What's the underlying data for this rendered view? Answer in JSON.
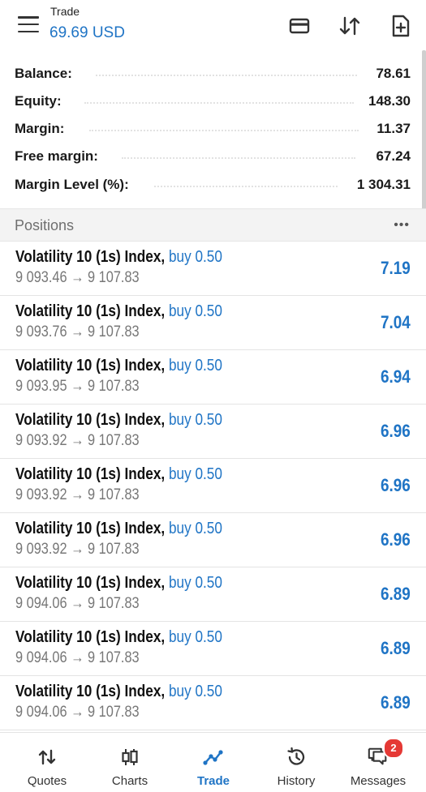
{
  "header": {
    "title": "Trade",
    "subtitle": "69.69 USD",
    "icons": [
      "menu-icon",
      "card-icon",
      "sort-icon",
      "new-order-icon"
    ]
  },
  "summary": [
    {
      "label": "Balance:",
      "value": "78.61"
    },
    {
      "label": "Equity:",
      "value": "148.30"
    },
    {
      "label": "Margin:",
      "value": "11.37"
    },
    {
      "label": "Free margin:",
      "value": "67.24"
    },
    {
      "label": "Margin Level (%):",
      "value": "1 304.31"
    }
  ],
  "positions": {
    "title": "Positions",
    "more_icon": "more-icon",
    "items": [
      {
        "symbol": "Volatility 10 (1s) Index,",
        "side": "buy 0.50",
        "prices": "9 093.46 → 9 107.83",
        "profit": "7.19"
      },
      {
        "symbol": "Volatility 10 (1s) Index,",
        "side": "buy 0.50",
        "prices": "9 093.76 → 9 107.83",
        "profit": "7.04"
      },
      {
        "symbol": "Volatility 10 (1s) Index,",
        "side": "buy 0.50",
        "prices": "9 093.95 → 9 107.83",
        "profit": "6.94"
      },
      {
        "symbol": "Volatility 10 (1s) Index,",
        "side": "buy 0.50",
        "prices": "9 093.92 → 9 107.83",
        "profit": "6.96"
      },
      {
        "symbol": "Volatility 10 (1s) Index,",
        "side": "buy 0.50",
        "prices": "9 093.92 → 9 107.83",
        "profit": "6.96"
      },
      {
        "symbol": "Volatility 10 (1s) Index,",
        "side": "buy 0.50",
        "prices": "9 093.92 → 9 107.83",
        "profit": "6.96"
      },
      {
        "symbol": "Volatility 10 (1s) Index,",
        "side": "buy 0.50",
        "prices": "9 094.06 → 9 107.83",
        "profit": "6.89"
      },
      {
        "symbol": "Volatility 10 (1s) Index,",
        "side": "buy 0.50",
        "prices": "9 094.06 → 9 107.83",
        "profit": "6.89"
      },
      {
        "symbol": "Volatility 10 (1s) Index,",
        "side": "buy 0.50",
        "prices": "9 094.06 → 9 107.83",
        "profit": "6.89"
      }
    ]
  },
  "nav": {
    "items": [
      {
        "label": "Quotes",
        "icon": "quotes-icon"
      },
      {
        "label": "Charts",
        "icon": "charts-icon"
      },
      {
        "label": "Trade",
        "icon": "trade-icon"
      },
      {
        "label": "History",
        "icon": "history-icon"
      },
      {
        "label": "Messages",
        "icon": "messages-icon"
      }
    ],
    "active": "Trade",
    "messages_badge": "2"
  },
  "colors": {
    "accent": "#1f74c5",
    "badge": "#e53935",
    "section_bg": "#f3f3f3"
  }
}
